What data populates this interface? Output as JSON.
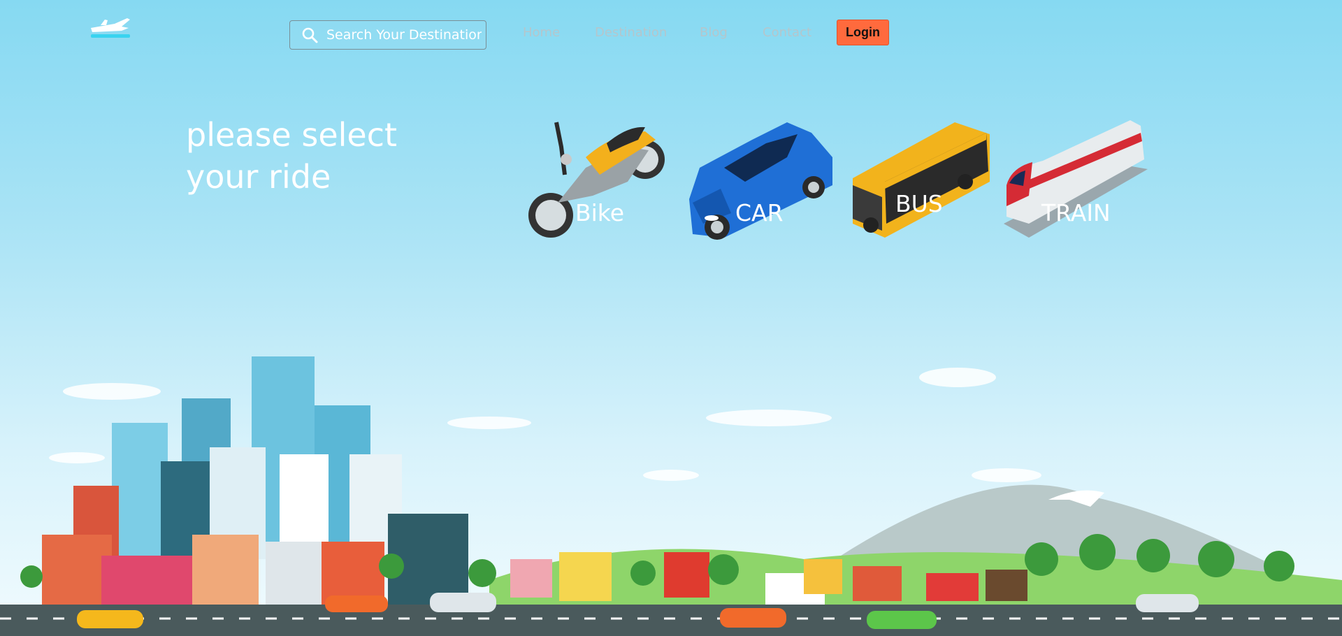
{
  "header": {
    "logo_icon": "airplane-logo-icon",
    "search": {
      "placeholder": "Search Your Destination",
      "icon": "search-icon"
    },
    "nav": [
      {
        "label": "Home"
      },
      {
        "label": "Destination"
      },
      {
        "label": "Blog"
      },
      {
        "label": "Contact"
      }
    ],
    "login_label": "Login"
  },
  "hero": {
    "headline": "please select your ride",
    "rides": [
      {
        "label": "Bike",
        "icon": "motorcycle-icon"
      },
      {
        "label": "CAR",
        "icon": "car-icon"
      },
      {
        "label": "BUS",
        "icon": "bus-icon"
      },
      {
        "label": "TRAIN",
        "icon": "train-icon"
      }
    ]
  },
  "colors": {
    "sky_top": "#86d9f2",
    "login_bg": "#ff6a3d",
    "nav_text": "#b4c6cc",
    "road": "#4a5a5c"
  }
}
